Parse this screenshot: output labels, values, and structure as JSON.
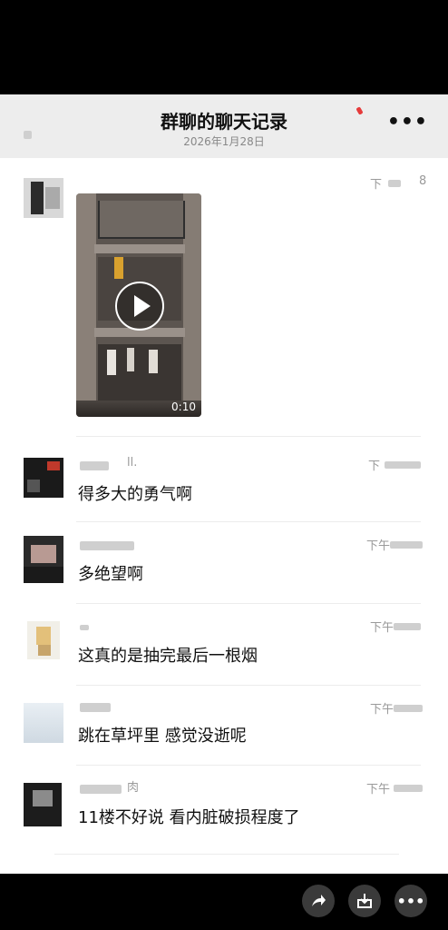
{
  "header": {
    "title": "群聊的聊天记录",
    "date": "2026年1月28日",
    "more_icon": "more-icon"
  },
  "messages": [
    {
      "type": "video",
      "time": "下",
      "duration": "0:10"
    },
    {
      "type": "text",
      "name": "ll.",
      "time": "下",
      "text": "得多大的勇气啊"
    },
    {
      "type": "text",
      "time": "下午",
      "text": "多绝望啊"
    },
    {
      "type": "text",
      "time": "下午",
      "text": "这真的是抽完最后一根烟"
    },
    {
      "type": "text",
      "time": "下午",
      "text": "跳在草坪里 感觉没逝呢"
    },
    {
      "type": "text",
      "name": "肉",
      "time": "下午",
      "text": "11楼不好说 看内脏破损程度了"
    }
  ],
  "bottom_actions": [
    "share-icon",
    "download-icon",
    "more-icon"
  ],
  "colors": {
    "header_bg": "#ededed",
    "panel_bg": "#ffffff",
    "page_bg": "#000000",
    "accent": "#e63b3b"
  }
}
